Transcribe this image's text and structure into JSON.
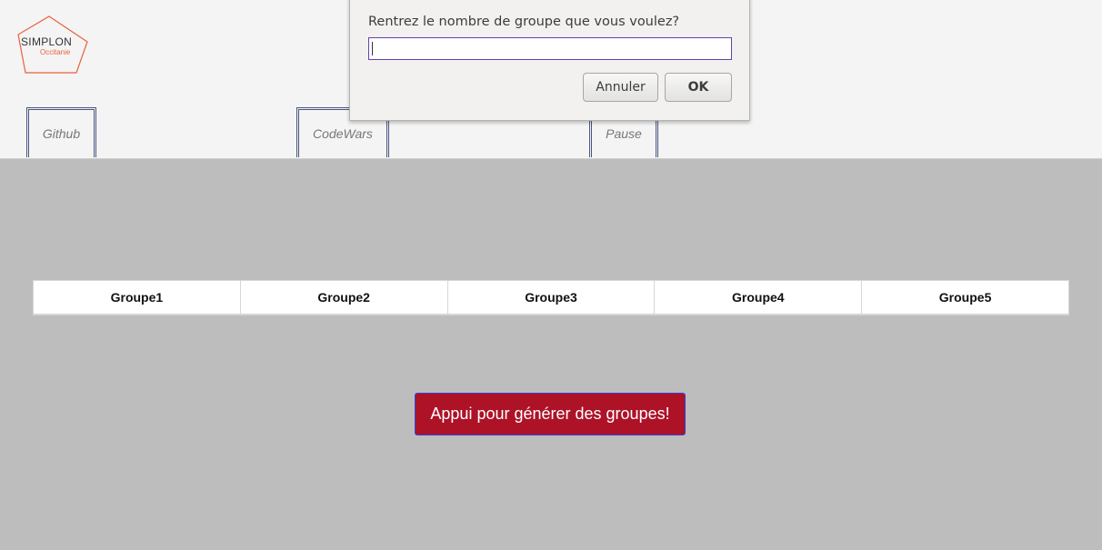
{
  "header": {
    "logo": {
      "line1": "SIMPLON",
      "line2": "Occitanie"
    },
    "nav": {
      "github": "Github",
      "codewars": "CodeWars",
      "pause": "Pause"
    }
  },
  "dialog": {
    "prompt": "Rentrez le nombre de groupe que vous voulez?",
    "input_value": "",
    "cancel_label": "Annuler",
    "ok_label": "OK"
  },
  "groups": {
    "headers": [
      "Groupe1",
      "Groupe2",
      "Groupe3",
      "Groupe4",
      "Groupe5"
    ]
  },
  "generate_button": {
    "label": "Appui pour générer des groupes!"
  },
  "colors": {
    "page_background": "#bdbdbd",
    "header_background": "#f4f4f4",
    "button_background": "#ad1227",
    "logo_accent": "#e8623a"
  },
  "icons": {
    "logo": "simplon-pentagon-logo"
  }
}
